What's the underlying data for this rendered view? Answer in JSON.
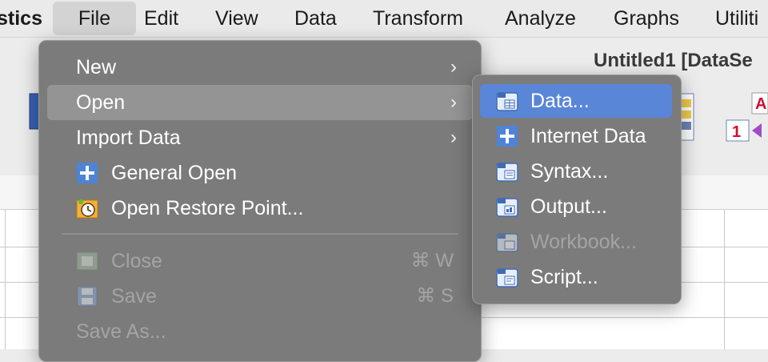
{
  "menubar": {
    "app_name": "stics",
    "items": [
      "File",
      "Edit",
      "View",
      "Data",
      "Transform",
      "Analyze",
      "Graphs",
      "Utiliti"
    ]
  },
  "window": {
    "title": "Untitled1 [DataSe"
  },
  "file_menu": {
    "items": [
      {
        "label": "New",
        "submenu": true
      },
      {
        "label": "Open",
        "submenu": true,
        "highlighted": true
      },
      {
        "label": "Import Data",
        "submenu": true
      },
      {
        "label": "General Open",
        "icon": "plus-icon"
      },
      {
        "label": "Open Restore Point...",
        "icon": "restore-point-icon"
      },
      {
        "label": "Close",
        "icon": "close-doc-icon",
        "shortcut": "⌘ W",
        "disabled": true
      },
      {
        "label": "Save",
        "icon": "save-icon",
        "shortcut": "⌘ S",
        "disabled": true
      },
      {
        "label": "Save As...",
        "disabled": true
      }
    ],
    "arrow": "›"
  },
  "open_submenu": {
    "items": [
      {
        "label": "Data...",
        "icon": "data-file-icon",
        "selected": true
      },
      {
        "label": "Internet Data",
        "icon": "plus-icon"
      },
      {
        "label": "Syntax...",
        "icon": "syntax-file-icon"
      },
      {
        "label": "Output...",
        "icon": "output-file-icon"
      },
      {
        "label": "Workbook...",
        "icon": "workbook-file-icon",
        "disabled": true
      },
      {
        "label": "Script...",
        "icon": "script-file-icon"
      }
    ]
  },
  "colors": {
    "menu_bg": "#7b7b7b",
    "highlight": "#949494",
    "selection": "#5a86d8",
    "disabled_text": "#a4a4a4"
  }
}
